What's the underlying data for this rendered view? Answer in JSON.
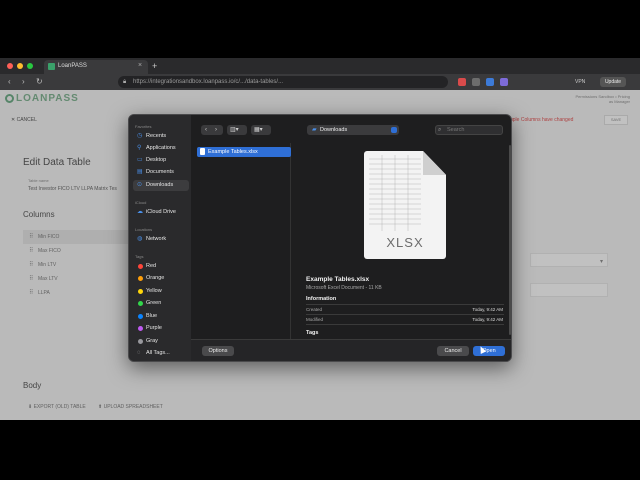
{
  "browser": {
    "tab_title": "LoanPASS",
    "tab_close": "×",
    "new_tab": "+",
    "url": "https://integrationsandbox.loanpass.io/c/.../data-tables/...",
    "vpn_label": "VPN",
    "update_label": "Update",
    "back": "‹",
    "forward": "›",
    "reload": "↻"
  },
  "page": {
    "logo": "LOANPASS",
    "header_right": "Permissions Sandbox • Pricing as Manager",
    "cancel_label": "CANCEL",
    "save_label": "SAVE",
    "changes_notice": "uple Columns have changed",
    "title": "Edit Data Table",
    "subtitle_label": "Table name",
    "subtitle_value": "Test Investor FICO LTV LLPA Matrix Tes",
    "columns_heading": "Columns",
    "columns": [
      {
        "label": "Min FICO",
        "active": true
      },
      {
        "label": "Max FICO",
        "active": false
      },
      {
        "label": "Min LTV",
        "active": false
      },
      {
        "label": "Max LTV",
        "active": false
      },
      {
        "label": "LLPA",
        "active": false
      }
    ],
    "body_heading": "Body",
    "export_label": "EXPORT (OLD) TABLE",
    "upload_label": "UPLOAD SPREADSHEET"
  },
  "dialog": {
    "sidebar": {
      "favorites_label": "Favorites",
      "favorites": [
        {
          "label": "Recents",
          "icon": "clock-icon",
          "glyph": "◷"
        },
        {
          "label": "Applications",
          "icon": "applications-icon",
          "glyph": "⚲"
        },
        {
          "label": "Desktop",
          "icon": "desktop-icon",
          "glyph": "▭"
        },
        {
          "label": "Documents",
          "icon": "documents-icon",
          "glyph": "▤"
        },
        {
          "label": "Downloads",
          "icon": "downloads-icon",
          "glyph": "⊙",
          "selected": true
        }
      ],
      "icloud_label": "iCloud",
      "icloud": [
        {
          "label": "iCloud Drive",
          "icon": "cloud-icon",
          "glyph": "☁"
        }
      ],
      "locations_label": "Locations",
      "locations": [
        {
          "label": "Network",
          "icon": "globe-icon",
          "glyph": "◍"
        }
      ],
      "tags_label": "Tags",
      "tags": [
        {
          "label": "Red",
          "color": "#ff453a"
        },
        {
          "label": "Orange",
          "color": "#ff9f0a"
        },
        {
          "label": "Yellow",
          "color": "#ffd60a"
        },
        {
          "label": "Green",
          "color": "#32d74b"
        },
        {
          "label": "Blue",
          "color": "#0a84ff"
        },
        {
          "label": "Purple",
          "color": "#bf5af2"
        },
        {
          "label": "Gray",
          "color": "#98989d"
        }
      ],
      "all_tags": "All Tags..."
    },
    "toolbar": {
      "location": "Downloads",
      "search_placeholder": "Search"
    },
    "file": {
      "name": "Example Tables.xlsx"
    },
    "preview": {
      "icon_label": "XLSX",
      "name": "Example Tables.xlsx",
      "kind": "Microsoft Excel Document - 11 KB",
      "info_heading": "Information",
      "created_label": "Created",
      "created_value": "Today, 9:42 AM",
      "modified_label": "Modified",
      "modified_value": "Today, 9:42 AM",
      "tags_heading": "Tags"
    },
    "buttons": {
      "options": "Options",
      "cancel": "Cancel",
      "open": "Open"
    }
  },
  "colors": {
    "accent": "#2f6fd6",
    "sidebar_bg": "#2a2a2c",
    "dialog_bg": "#1e1e1f"
  }
}
